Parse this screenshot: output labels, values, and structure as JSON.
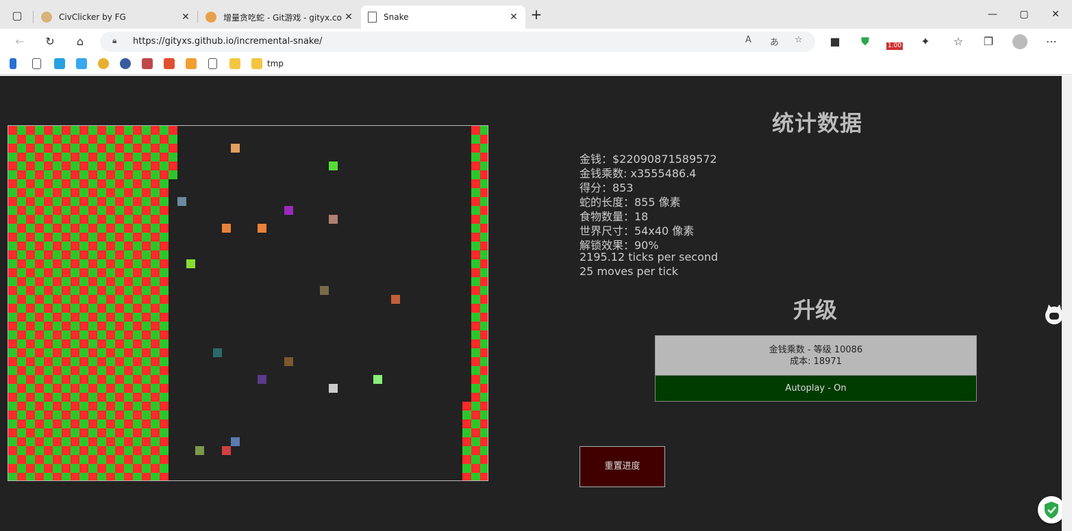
{
  "browser": {
    "tabs": [
      {
        "title": "CivClicker by FG",
        "active": false
      },
      {
        "title": "增量贪吃蛇 - Git游戏 - gityx.com",
        "active": false
      },
      {
        "title": "Snake",
        "active": true
      }
    ],
    "url": "https://gityxs.github.io/incremental-snake/",
    "bookmark_folder": "tmp",
    "extension_badge": "1.00"
  },
  "page": {
    "stats_heading": "统计数据",
    "stats": [
      "金钱：$22090871589572",
      "金钱乘数: x3555486.4",
      "得分：853",
      "蛇的长度：855 像素",
      "食物数量：18",
      "世界尺寸：54x40 像素",
      "解锁效果：90%",
      "2195.12 ticks per second",
      "25 moves per tick"
    ],
    "upgrades_heading": "升级",
    "upgrade": {
      "name": "金钱乘数 - 等级 10086",
      "cost": "成本: 18971"
    },
    "autoplay": "Autoplay - On",
    "reset": "重置进度"
  },
  "colors": {
    "background": "#222222",
    "snake_a": "#ff2a2a",
    "snake_b": "#2ac72a",
    "autoplay_bg": "#003b00",
    "reset_bg": "#400000"
  },
  "game": {
    "grid_cols": 54,
    "grid_rows": 40,
    "food_count": 18
  }
}
